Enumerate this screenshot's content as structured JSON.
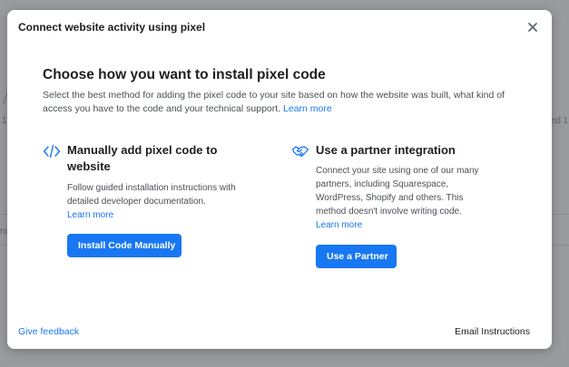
{
  "modal": {
    "title": "Connect website activity using pixel",
    "heading": "Choose how you want to install pixel code",
    "description": "Select the best method for adding the pixel code to your site based on how the website was built, what kind of access you have to the code and your technical support.",
    "description_link": "Learn more"
  },
  "options": {
    "manual": {
      "icon": "code-icon",
      "title": "Manually add pixel code to website",
      "description": "Follow guided installation instructions with detailed developer documentation.",
      "link": "Learn more",
      "button": "Install Code Manually"
    },
    "partner": {
      "icon": "handshake-icon",
      "title": "Use a partner integration",
      "description": "Connect your site using one of our many partners, including Squarespace, WordPress, Shopify and others. This method doesn't involve writing code.",
      "link": "Learn more",
      "button": "Use a Partner"
    }
  },
  "footer": {
    "feedback": "Give feedback",
    "email": "Email Instructions"
  },
  "background": {
    "left_fragment_1": "1",
    "left_fragment_2": "rs",
    "right_fragment": "ted 1"
  },
  "colors": {
    "accent": "#1877f2",
    "text": "#1c1e21",
    "muted": "#4b4f56",
    "overlay": "#9a9b9d"
  }
}
